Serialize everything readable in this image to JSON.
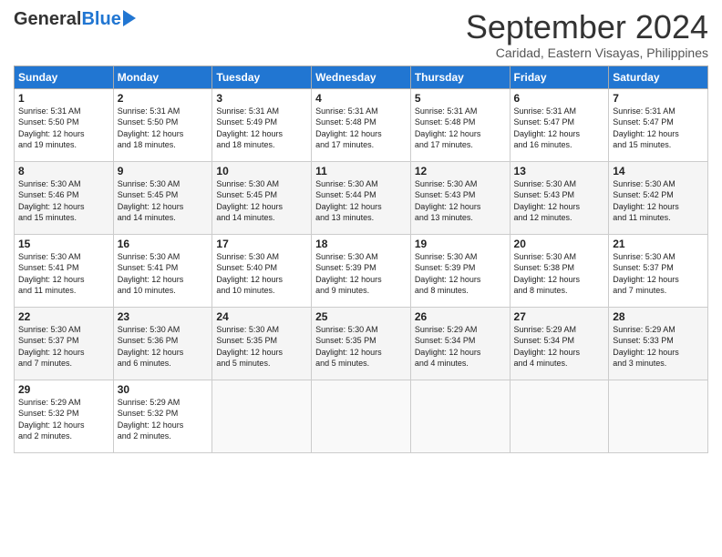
{
  "header": {
    "logo_general": "General",
    "logo_blue": "Blue",
    "month_title": "September 2024",
    "subtitle": "Caridad, Eastern Visayas, Philippines"
  },
  "weekdays": [
    "Sunday",
    "Monday",
    "Tuesday",
    "Wednesday",
    "Thursday",
    "Friday",
    "Saturday"
  ],
  "weeks": [
    [
      {
        "day": "1",
        "info": "Sunrise: 5:31 AM\nSunset: 5:50 PM\nDaylight: 12 hours\nand 19 minutes."
      },
      {
        "day": "2",
        "info": "Sunrise: 5:31 AM\nSunset: 5:50 PM\nDaylight: 12 hours\nand 18 minutes."
      },
      {
        "day": "3",
        "info": "Sunrise: 5:31 AM\nSunset: 5:49 PM\nDaylight: 12 hours\nand 18 minutes."
      },
      {
        "day": "4",
        "info": "Sunrise: 5:31 AM\nSunset: 5:48 PM\nDaylight: 12 hours\nand 17 minutes."
      },
      {
        "day": "5",
        "info": "Sunrise: 5:31 AM\nSunset: 5:48 PM\nDaylight: 12 hours\nand 17 minutes."
      },
      {
        "day": "6",
        "info": "Sunrise: 5:31 AM\nSunset: 5:47 PM\nDaylight: 12 hours\nand 16 minutes."
      },
      {
        "day": "7",
        "info": "Sunrise: 5:31 AM\nSunset: 5:47 PM\nDaylight: 12 hours\nand 15 minutes."
      }
    ],
    [
      {
        "day": "8",
        "info": "Sunrise: 5:30 AM\nSunset: 5:46 PM\nDaylight: 12 hours\nand 15 minutes."
      },
      {
        "day": "9",
        "info": "Sunrise: 5:30 AM\nSunset: 5:45 PM\nDaylight: 12 hours\nand 14 minutes."
      },
      {
        "day": "10",
        "info": "Sunrise: 5:30 AM\nSunset: 5:45 PM\nDaylight: 12 hours\nand 14 minutes."
      },
      {
        "day": "11",
        "info": "Sunrise: 5:30 AM\nSunset: 5:44 PM\nDaylight: 12 hours\nand 13 minutes."
      },
      {
        "day": "12",
        "info": "Sunrise: 5:30 AM\nSunset: 5:43 PM\nDaylight: 12 hours\nand 13 minutes."
      },
      {
        "day": "13",
        "info": "Sunrise: 5:30 AM\nSunset: 5:43 PM\nDaylight: 12 hours\nand 12 minutes."
      },
      {
        "day": "14",
        "info": "Sunrise: 5:30 AM\nSunset: 5:42 PM\nDaylight: 12 hours\nand 11 minutes."
      }
    ],
    [
      {
        "day": "15",
        "info": "Sunrise: 5:30 AM\nSunset: 5:41 PM\nDaylight: 12 hours\nand 11 minutes."
      },
      {
        "day": "16",
        "info": "Sunrise: 5:30 AM\nSunset: 5:41 PM\nDaylight: 12 hours\nand 10 minutes."
      },
      {
        "day": "17",
        "info": "Sunrise: 5:30 AM\nSunset: 5:40 PM\nDaylight: 12 hours\nand 10 minutes."
      },
      {
        "day": "18",
        "info": "Sunrise: 5:30 AM\nSunset: 5:39 PM\nDaylight: 12 hours\nand 9 minutes."
      },
      {
        "day": "19",
        "info": "Sunrise: 5:30 AM\nSunset: 5:39 PM\nDaylight: 12 hours\nand 8 minutes."
      },
      {
        "day": "20",
        "info": "Sunrise: 5:30 AM\nSunset: 5:38 PM\nDaylight: 12 hours\nand 8 minutes."
      },
      {
        "day": "21",
        "info": "Sunrise: 5:30 AM\nSunset: 5:37 PM\nDaylight: 12 hours\nand 7 minutes."
      }
    ],
    [
      {
        "day": "22",
        "info": "Sunrise: 5:30 AM\nSunset: 5:37 PM\nDaylight: 12 hours\nand 7 minutes."
      },
      {
        "day": "23",
        "info": "Sunrise: 5:30 AM\nSunset: 5:36 PM\nDaylight: 12 hours\nand 6 minutes."
      },
      {
        "day": "24",
        "info": "Sunrise: 5:30 AM\nSunset: 5:35 PM\nDaylight: 12 hours\nand 5 minutes."
      },
      {
        "day": "25",
        "info": "Sunrise: 5:30 AM\nSunset: 5:35 PM\nDaylight: 12 hours\nand 5 minutes."
      },
      {
        "day": "26",
        "info": "Sunrise: 5:29 AM\nSunset: 5:34 PM\nDaylight: 12 hours\nand 4 minutes."
      },
      {
        "day": "27",
        "info": "Sunrise: 5:29 AM\nSunset: 5:34 PM\nDaylight: 12 hours\nand 4 minutes."
      },
      {
        "day": "28",
        "info": "Sunrise: 5:29 AM\nSunset: 5:33 PM\nDaylight: 12 hours\nand 3 minutes."
      }
    ],
    [
      {
        "day": "29",
        "info": "Sunrise: 5:29 AM\nSunset: 5:32 PM\nDaylight: 12 hours\nand 2 minutes."
      },
      {
        "day": "30",
        "info": "Sunrise: 5:29 AM\nSunset: 5:32 PM\nDaylight: 12 hours\nand 2 minutes."
      },
      {
        "day": "",
        "info": ""
      },
      {
        "day": "",
        "info": ""
      },
      {
        "day": "",
        "info": ""
      },
      {
        "day": "",
        "info": ""
      },
      {
        "day": "",
        "info": ""
      }
    ]
  ]
}
